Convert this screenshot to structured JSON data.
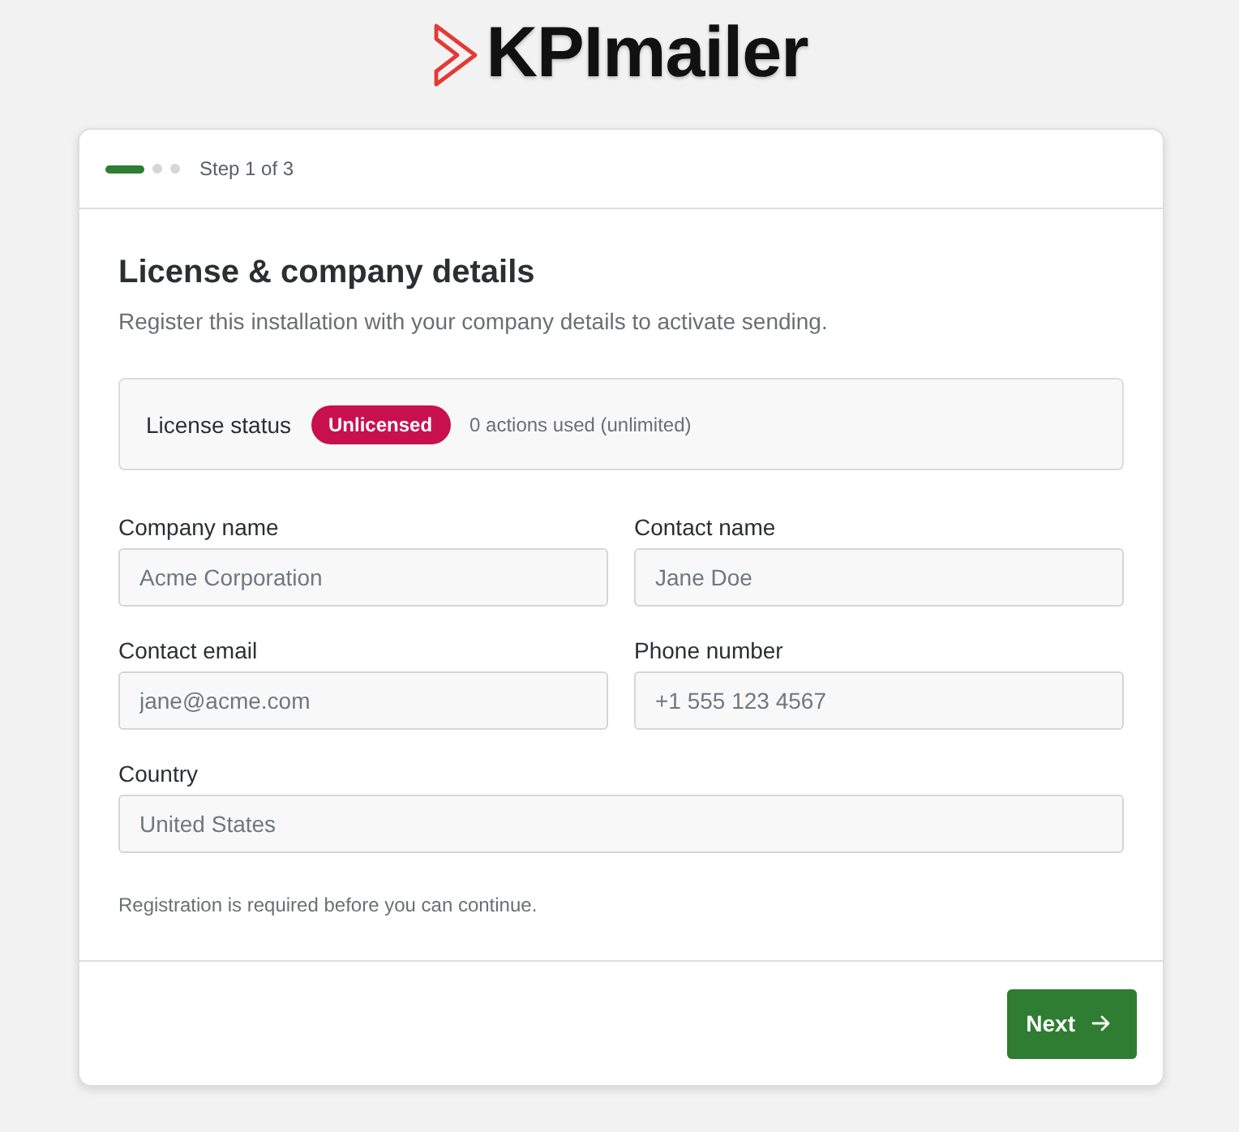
{
  "logo": {
    "text": "KPImailer"
  },
  "progress": {
    "steps": [
      {
        "selected": true
      },
      {
        "selected": false
      },
      {
        "selected": false
      }
    ],
    "label": "Step 1 of 3"
  },
  "title": "License & company details",
  "subtitle": "Register this installation with your company details to activate sending.",
  "license": {
    "label": "License status",
    "badge": "Unlicensed",
    "usage": "0 actions used (unlimited)"
  },
  "fields": [
    {
      "label": "Company name",
      "placeholder": "Acme Corporation"
    },
    {
      "label": "Contact name",
      "placeholder": "Jane Doe"
    },
    {
      "label": "Contact email",
      "placeholder": "jane@acme.com"
    },
    {
      "label": "Phone number",
      "placeholder": "+1 555 123 4567"
    },
    {
      "label": "Country",
      "placeholder": "United States"
    }
  ],
  "note": "Registration is required before you can continue.",
  "buttons": [
    {
      "label": "Next"
    }
  ]
}
